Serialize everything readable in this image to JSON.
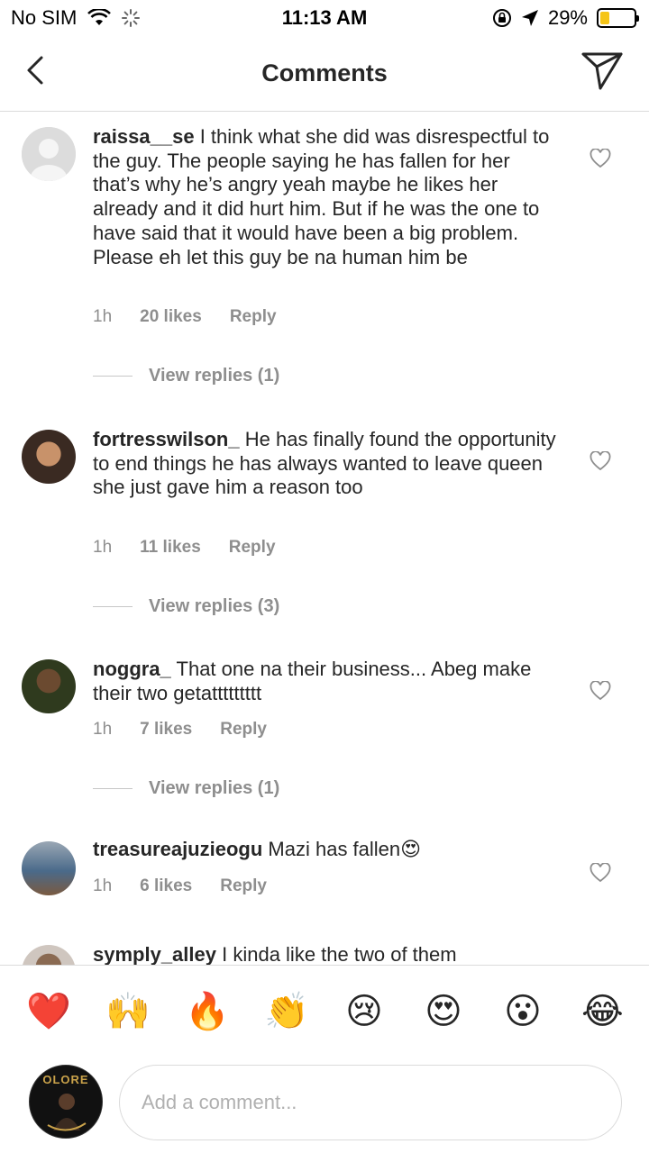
{
  "status_bar": {
    "carrier": "No SIM",
    "time": "11:13 AM",
    "battery_percent": "29%",
    "battery_level": 0.29,
    "battery_color": "#f5c518"
  },
  "header": {
    "title": "Comments",
    "back_icon": "chevron-left-icon",
    "send_icon": "paper-plane-icon"
  },
  "comments": [
    {
      "username": "raissa__se",
      "text": "I think what she did was disrespectful to the guy. The people saying he has fallen for her that’s why he’s angry yeah maybe he likes her already and it did hurt him. But if he was the one to have said that it would have been a big problem. Please eh let this guy be na human him be",
      "time": "1h",
      "likes": "20 likes",
      "reply": "Reply",
      "view_replies": "View replies (1)"
    },
    {
      "username": "fortresswilson_",
      "text": "He has finally found the opportunity to end things he has always wanted to leave queen she just gave him a reason too",
      "time": "1h",
      "likes": "11 likes",
      "reply": "Reply",
      "view_replies": "View replies (3)"
    },
    {
      "username": "noggra_",
      "text": "That one na their business... Abeg make their two getattttttttt",
      "time": "1h",
      "likes": "7 likes",
      "reply": "Reply",
      "view_replies": "View replies (1)"
    },
    {
      "username": "treasureajuzieogu",
      "text": "Mazi has fallen😍",
      "time": "1h",
      "likes": "6 likes",
      "reply": "Reply"
    },
    {
      "username": "symply_alley",
      "text": "I kinda like the two of them"
    }
  ],
  "emojis": [
    "❤️",
    "🙌",
    "🔥",
    "👏",
    "😢",
    "😍",
    "😮",
    "😂"
  ],
  "composer": {
    "placeholder": "Add a comment...",
    "avatar_text": "OLORE"
  }
}
